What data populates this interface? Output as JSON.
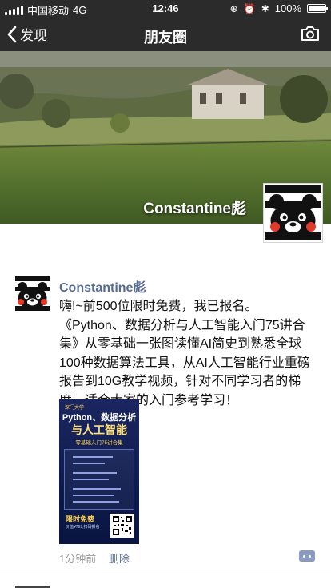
{
  "status_bar": {
    "carrier": "中国移动",
    "network": "4G",
    "time": "12:46",
    "battery_percent": "100%",
    "battery_level": 1.0,
    "lock_glyph": "⊕",
    "alarm_glyph": "⏰",
    "bluetooth_glyph": "✱"
  },
  "nav": {
    "back_label": "发现",
    "title": "朋友圈",
    "back_icon": "chevron-left-icon",
    "camera_icon": "camera-icon"
  },
  "cover": {
    "user_name": "Constantine彪"
  },
  "post": {
    "author": "Constantine彪",
    "text": "嗨!~前500位限时免费，我已报名。《Python、数据分析与人工智能入门75讲合集》从零基础一张图读懂AI简史到熟悉全球100种数据算法工具，从AI人工智能行业重磅报告到10G教学视频，针对不同学习者的梯度，适合大家的入门参考学习！",
    "time": "1分钟前",
    "delete_label": "删除",
    "poster": {
      "brand": "深门大学",
      "title_line1": "Python、数据分析",
      "title_line2": "与人工智能",
      "subtitle": "零基础入门75讲合集",
      "free_label": "限时免费",
      "price_note": "价值¥799,扫码报名"
    }
  },
  "colors": {
    "nav_bg": "#2b2b2b",
    "link_blue": "#576b95",
    "meta_gray": "#9b9b9b",
    "poster_bg": "#0d1b4c",
    "poster_accent": "#ffd257"
  }
}
